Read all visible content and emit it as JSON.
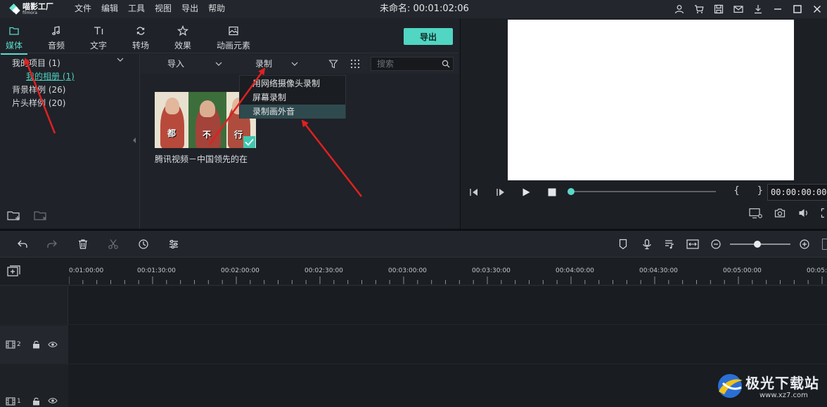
{
  "app": {
    "logo_name": "喵影工厂",
    "logo_sub": "filmora"
  },
  "menu": [
    "文件",
    "编辑",
    "工具",
    "视图",
    "导出",
    "帮助"
  ],
  "document_title": "未命名: 00:01:02:06",
  "window_icons": [
    "user-icon",
    "cart-icon",
    "save-icon",
    "mail-icon",
    "download-icon",
    "minimize-icon",
    "maximize-icon",
    "close-icon"
  ],
  "tabs": [
    {
      "label": "媒体",
      "icon": "folder-icon",
      "active": true
    },
    {
      "label": "音频",
      "icon": "music-note-icon"
    },
    {
      "label": "文字",
      "icon": "text-icon"
    },
    {
      "label": "转场",
      "icon": "transition-icon"
    },
    {
      "label": "效果",
      "icon": "effects-icon"
    },
    {
      "label": "动画元素",
      "icon": "image-icon"
    }
  ],
  "export_label": "导出",
  "tree": {
    "my_project": "我的项目 (1)",
    "my_album": "我的相册 (1)",
    "bg_samples": "背景样例 (26)",
    "intro_samples": "片头样例 (20)"
  },
  "media_toolbar": {
    "import_label": "导入",
    "record_label": "录制",
    "search_placeholder": "搜索"
  },
  "record_menu": [
    {
      "label": "用网络摄像头录制"
    },
    {
      "label": "屏幕录制"
    },
    {
      "label": "录制画外音",
      "highlighted": true
    }
  ],
  "media_item": {
    "name": "腾讯视频－中国领先的在",
    "captions": [
      "都",
      "不",
      "行"
    ],
    "selected": true
  },
  "preview": {
    "timecode": "00:00:00:00",
    "brackets": "{ }",
    "progress": 0
  },
  "timeline": {
    "ruler_labels": [
      "00:01:00:00",
      "00:01:30:00",
      "00:02:00:00",
      "00:02:30:00",
      "00:03:00:00",
      "00:03:30:00",
      "00:04:00:00",
      "00:04:30:00",
      "00:05:00:00",
      "00:05:30:00"
    ],
    "tracks": [
      {
        "number": "2"
      },
      {
        "number": "1"
      }
    ],
    "zoom_level": 0.45
  },
  "watermark": {
    "text": "极光下载站",
    "url": "www.xz7.com"
  },
  "colors": {
    "accent": "#5ad9c9",
    "export_button": "#50d6c3",
    "arrow": "#e02020"
  }
}
